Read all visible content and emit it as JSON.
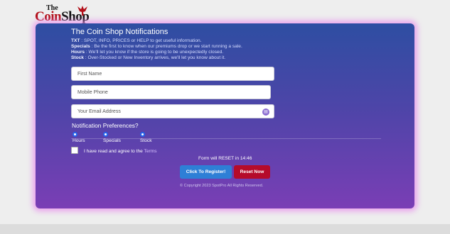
{
  "logo": {
    "line1": "The",
    "line2_a": "Coin",
    "line2_b": "Shop",
    "icon": "eagle-icon",
    "brand_red": "#b3101a"
  },
  "card": {
    "title": "The Coin Shop Notifications",
    "info": [
      {
        "key": "TXT",
        "text": " : SPOT, INFO, PRICES or HELP to get useful information."
      },
      {
        "key": "Specials",
        "text": " : Be the first to know when our premiums drop or we start running a sale."
      },
      {
        "key": "Hours",
        "text": " : We'll let you know if the store is going to be unexpectedly closed."
      },
      {
        "key": "Stock",
        "text": " : Over-Stocked or New Inventory arrives, we'll let you know about it."
      }
    ],
    "gradient_top": "#2e4ea2",
    "gradient_bottom": "#7a3eb5",
    "glow": "#e88cec"
  },
  "form": {
    "first_name_placeholder": "First Name",
    "phone_placeholder": "Mobile Phone",
    "email_placeholder": "Your Email Address",
    "email_icon": "contact-card-icon",
    "prefs_title": "Notification Preferences?",
    "prefs": [
      {
        "label": "Hours",
        "checked": true
      },
      {
        "label": "Specials",
        "checked": true
      },
      {
        "label": "Stock",
        "checked": true
      }
    ],
    "agree_text": "I have read and agree to the",
    "agree_link": "Terms",
    "agree_checked": false,
    "reset_timer": "Form will RESET in 14:46",
    "register_label": "Click To Register!",
    "reset_label": "Reset Now",
    "register_color": "#2e7fd6",
    "reset_color": "#b50b2a",
    "copyright": "© Copyright 2023 SpotPro All Rights Reserved."
  }
}
